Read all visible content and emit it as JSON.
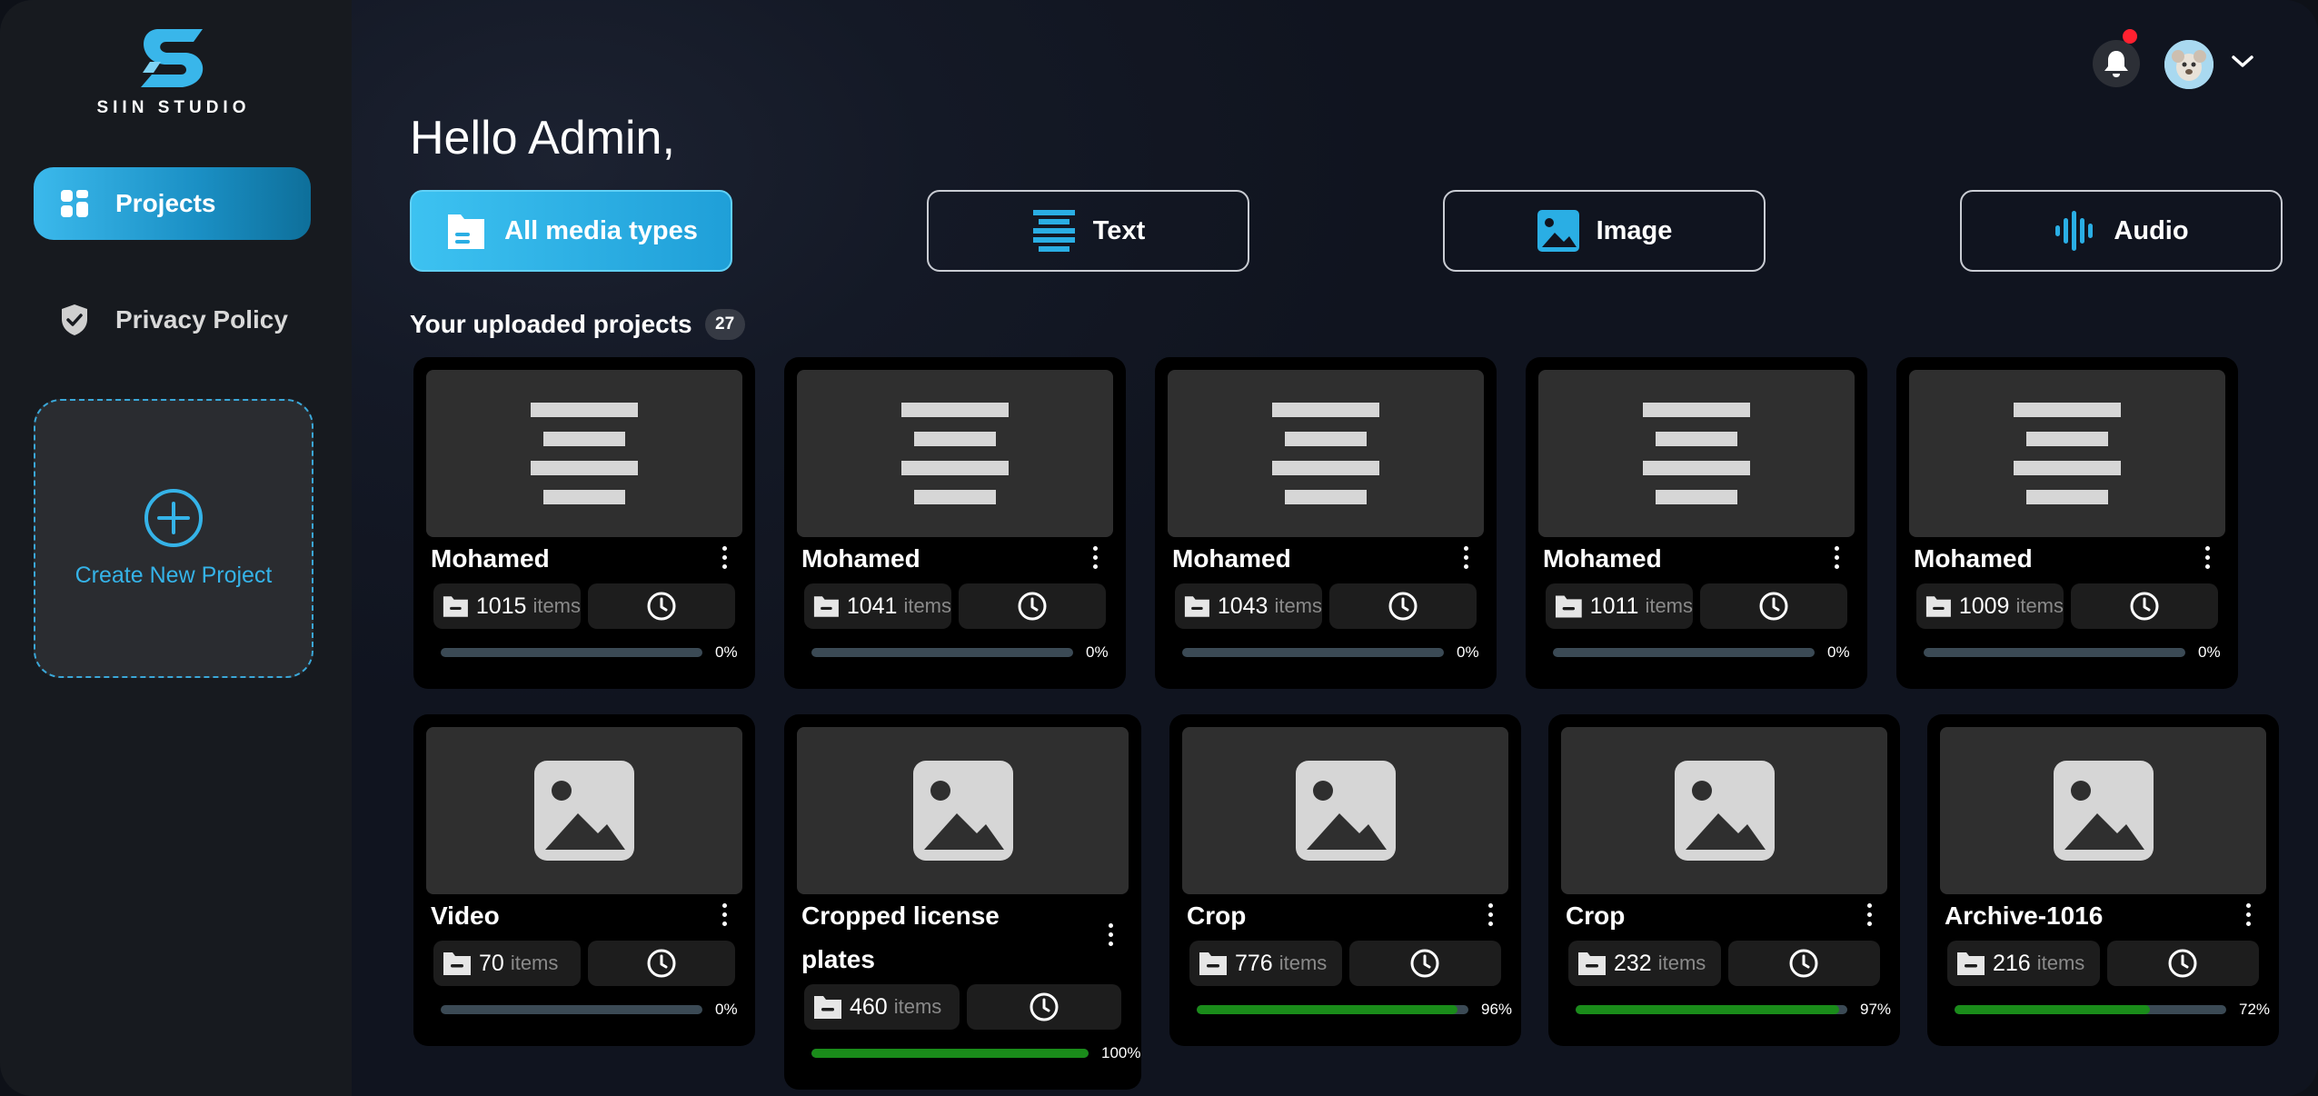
{
  "brand": {
    "name": "SIIN STUDIO"
  },
  "sidebar": {
    "items": [
      {
        "label": "Projects",
        "icon": "grid-icon",
        "active": true
      },
      {
        "label": "Privacy Policy",
        "icon": "shield-check-icon",
        "active": false
      }
    ],
    "create_label": "Create New Project"
  },
  "header": {
    "greeting": "Hello Admin,",
    "notification_dot": true
  },
  "filters": [
    {
      "label": "All media types",
      "icon": "folder-icon",
      "active": true
    },
    {
      "label": "Text",
      "icon": "text-lines-icon",
      "active": false
    },
    {
      "label": "Image",
      "icon": "image-icon",
      "active": false
    },
    {
      "label": "Audio",
      "icon": "audio-wave-icon",
      "active": false
    }
  ],
  "section": {
    "title": "Your uploaded projects",
    "count": "27"
  },
  "items_unit": "items",
  "projects": [
    {
      "name": "Mohamed",
      "items": "1015",
      "progress": "0%",
      "progress_value": 0,
      "type": "text"
    },
    {
      "name": "Mohamed",
      "items": "1041",
      "progress": "0%",
      "progress_value": 0,
      "type": "text"
    },
    {
      "name": "Mohamed",
      "items": "1043",
      "progress": "0%",
      "progress_value": 0,
      "type": "text"
    },
    {
      "name": "Mohamed",
      "items": "1011",
      "progress": "0%",
      "progress_value": 0,
      "type": "text"
    },
    {
      "name": "Mohamed",
      "items": "1009",
      "progress": "0%",
      "progress_value": 0,
      "type": "text"
    },
    {
      "name": "Video",
      "items": "70",
      "progress": "0%",
      "progress_value": 0,
      "type": "image"
    },
    {
      "name": "Cropped license plates",
      "name_line1": "Cropped license",
      "name_line2": "plates",
      "items": "460",
      "progress": "100%",
      "progress_value": 100,
      "type": "image"
    },
    {
      "name": "Crop",
      "items": "776",
      "progress": "96%",
      "progress_value": 96,
      "type": "image"
    },
    {
      "name": "Crop",
      "items": "232",
      "progress": "97%",
      "progress_value": 97,
      "type": "image"
    },
    {
      "name": "Archive-1016",
      "items": "216",
      "progress": "72%",
      "progress_value": 72,
      "type": "image"
    }
  ],
  "colors": {
    "accent": "#3bb9ec",
    "progress_fill": "#1a8c1a",
    "progress_track": "#3b4a55",
    "notification": "#ff2130"
  }
}
